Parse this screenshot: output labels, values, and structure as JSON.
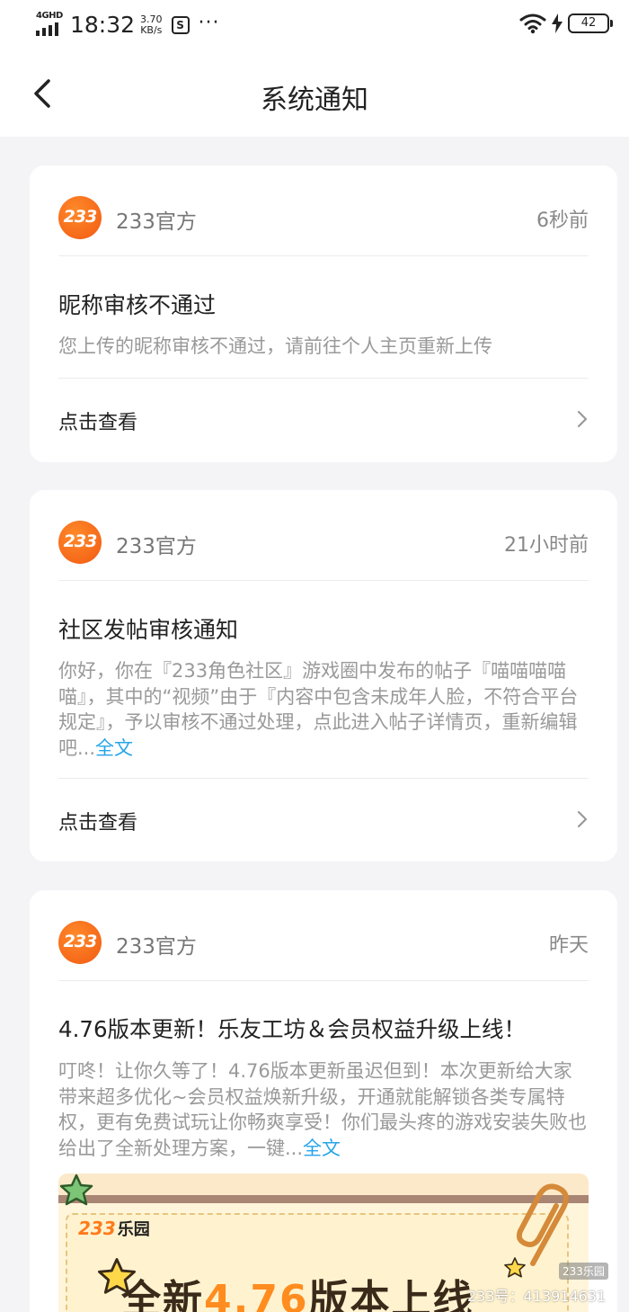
{
  "status_bar": {
    "network": "4GHD",
    "time": "18:32",
    "speed_value": "3.70",
    "speed_unit": "KB/s",
    "app_icon_letter": "S",
    "more": "···",
    "battery": "42"
  },
  "header": {
    "title": "系统通知"
  },
  "colors": {
    "accent_link": "#26a4e8",
    "brand_orange": "#f15a12"
  },
  "notifications": [
    {
      "logo_text": "233",
      "sender": "233官方",
      "time": "6秒前",
      "title": "昵称审核不通过",
      "body": "您上传的昵称审核不通过，请前往个人主页重新上传",
      "action": "点击查看"
    },
    {
      "logo_text": "233",
      "sender": "233官方",
      "time": "21小时前",
      "title": "社区发帖审核通知",
      "body": "你好，你在『233角色社区』游戏圈中发布的帖子『喵喵喵喵喵』，其中的“视频”由于『内容中包含未成年人脸，不符合平台规定』，予以审核不通过处理，点此进入帖子详情页，重新编辑吧...",
      "more": "全文",
      "action": "点击查看"
    },
    {
      "logo_text": "233",
      "sender": "233官方",
      "time": "昨天",
      "title": "4.76版本更新！乐友工坊＆会员权益升级上线！",
      "body": "叮咚！让你久等了！4.76版本更新虽迟但到！本次更新给大家带来超多优化~会员权益焕新升级，开通就能解锁各类专属特权，更有免费试玩让你畅爽享受！你们最头疼的游戏安装失败也给出了全新处理方案，一键...",
      "more": "全文",
      "banner": {
        "logo_num": "233",
        "logo_text": "乐园",
        "headline_a": "全新",
        "headline_b": "4.76",
        "headline_c": "版本上线"
      }
    }
  ],
  "watermark": {
    "badge": "233乐园",
    "text": "233号：413914631"
  }
}
